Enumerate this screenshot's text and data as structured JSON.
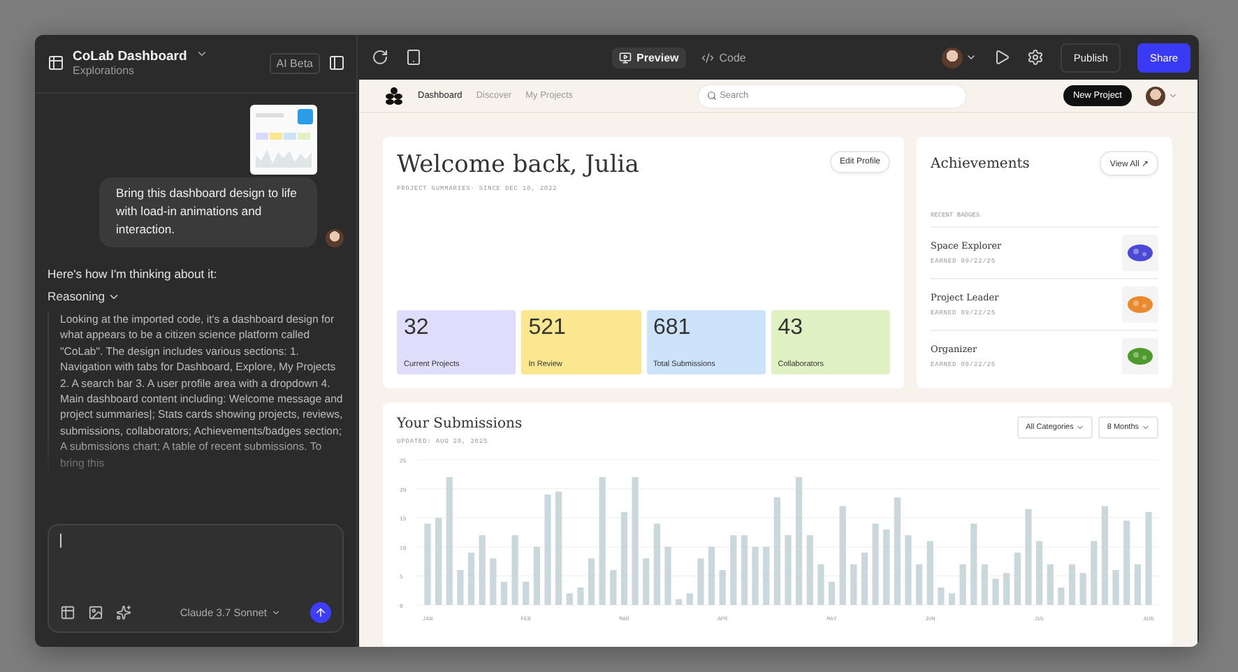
{
  "sidebar": {
    "project_title": "CoLab Dashboard",
    "project_subtitle": "Explorations",
    "badge": "AI Beta",
    "chat": {
      "user_message": "Bring this dashboard design to life with load-in animations and interaction.",
      "reply_intro": "Here's how I'm thinking about it:",
      "reasoning_label": "Reasoning",
      "reasoning_expanded": true,
      "reasoning_text": "Looking at the imported code, it's a dashboard design for what appears to be a citizen science platform called \"CoLab\". The design includes various sections: 1. Navigation with tabs for Dashboard, Explore, My Projects 2. A search bar 3. A user profile area with a dropdown 4. Main dashboard content including: Welcome message and project summaries|; Stats cards showing projects, reviews, submissions, collaborators; Achievements/badges section; A submissions chart; A table of recent submissions. To bring this"
    },
    "composer": {
      "model": "Claude 3.7 Sonnet"
    }
  },
  "toolbar": {
    "tabs": [
      {
        "label": "Preview",
        "selected": true
      },
      {
        "label": "Code",
        "selected": false
      }
    ],
    "publish": "Publish",
    "share": "Share"
  },
  "app": {
    "nav": [
      {
        "label": "Dashboard",
        "selected": true
      },
      {
        "label": "Discover",
        "selected": false
      },
      {
        "label": "My Projects",
        "selected": false
      }
    ],
    "search": {
      "placeholder": "Search"
    },
    "new_project": "New Project",
    "welcome": {
      "title": "Welcome back, Julia",
      "subtitle": "PROJECT SUMMARIES· SINCE DEC 10, 2022",
      "edit": "Edit Profile",
      "stats": [
        {
          "value": "32",
          "label": "Current Projects",
          "color": "#e0dcfb"
        },
        {
          "value": "521",
          "label": "In Review",
          "color": "#fbe78f"
        },
        {
          "value": "681",
          "label": "Total Submissions",
          "color": "#cde3fb"
        },
        {
          "value": "43",
          "label": "Collaborators",
          "color": "#e0f2c4"
        }
      ]
    },
    "achievements": {
      "title": "Achievements",
      "view_all": "View All ↗",
      "section": "RECENT BADGES",
      "badges": [
        {
          "name": "Space Explorer",
          "earned": "EARNED 09/22/25",
          "color": "#4a4ad6"
        },
        {
          "name": "Project Leader",
          "earned": "EARNED 09/22/25",
          "color": "#e98a2e"
        },
        {
          "name": "Organizer",
          "earned": "EARNED 09/22/25",
          "color": "#4f9a2c"
        }
      ]
    },
    "submissions": {
      "title": "Your Submissions",
      "updated": "UPDATED: AUG 20, 2025",
      "filters": [
        "All Categories",
        "8 Months"
      ],
      "chart_data": {
        "type": "bar",
        "grid": true,
        "ylim": [
          0,
          25
        ],
        "yticks": [
          0,
          5,
          10,
          15,
          20,
          25
        ],
        "categories": [
          "JAN",
          null,
          null,
          null,
          null,
          null,
          null,
          null,
          null,
          "FEB",
          null,
          null,
          null,
          null,
          null,
          null,
          null,
          null,
          "MAR",
          null,
          null,
          null,
          null,
          null,
          null,
          null,
          null,
          "APR",
          null,
          null,
          null,
          null,
          null,
          null,
          null,
          null,
          null,
          "MAY",
          null,
          null,
          null,
          null,
          null,
          null,
          null,
          null,
          "JUN",
          null,
          null,
          null,
          null,
          null,
          null,
          null,
          null,
          null,
          "JUL",
          null,
          null,
          null,
          null,
          null,
          null,
          null,
          null,
          null,
          "AUG"
        ],
        "values": [
          14,
          15,
          22,
          6,
          9,
          12,
          8,
          4,
          12,
          4,
          10,
          19,
          19.5,
          2,
          3,
          8,
          22,
          6,
          16,
          22,
          8,
          14,
          10,
          1,
          2,
          8,
          10,
          6,
          12,
          12,
          10,
          10,
          18.5,
          12,
          22,
          12,
          7,
          4,
          17,
          7,
          9,
          14,
          13,
          18.5,
          12,
          7,
          11,
          3,
          2,
          7,
          14,
          7,
          4.5,
          5.5,
          9,
          16.5,
          11,
          7,
          3,
          7,
          5.5,
          11,
          17,
          6,
          14.5,
          7,
          16
        ]
      }
    }
  }
}
